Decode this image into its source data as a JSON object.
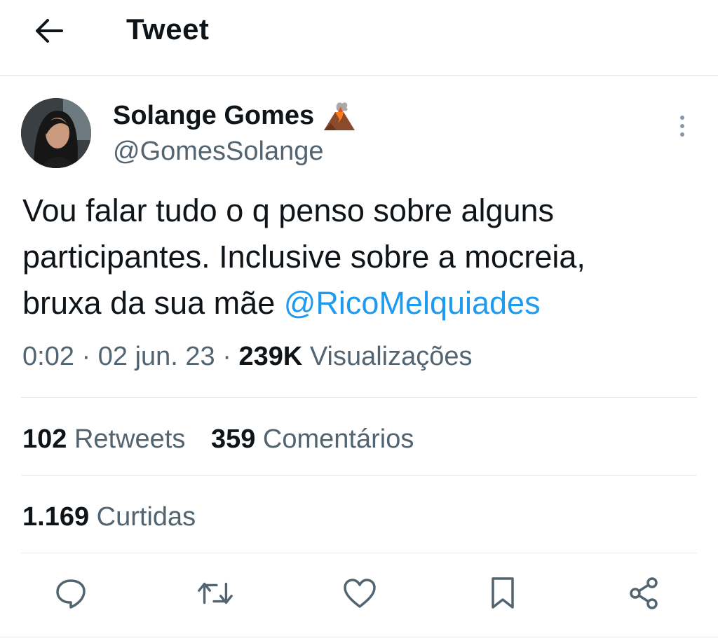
{
  "header": {
    "title": "Tweet",
    "back_icon": "arrow-left-icon"
  },
  "tweet": {
    "author_name": "Solange Gomes",
    "author_emoji": "volcano-icon",
    "author_handle": "@GomesSolange",
    "text_lines": [
      "Vou falar tudo o q penso sobre alguns",
      "participantes. Inclusive sobre a mocreia,",
      "bruxa da sua mãe "
    ],
    "mention": "@RicoMelquiades",
    "time": "0:02",
    "separator": " · ",
    "date": "02 jun. 23",
    "views_count": "239K",
    "views_label": "Visualizações"
  },
  "stats": {
    "retweets_count": "102",
    "retweets_label": "Retweets",
    "comments_count": "359",
    "comments_label": "Comentários",
    "likes_count": "1.169",
    "likes_label": "Curtidas"
  },
  "actions": [
    {
      "icon": "reply-icon"
    },
    {
      "icon": "retweet-icon"
    },
    {
      "icon": "like-icon"
    },
    {
      "icon": "bookmark-icon"
    },
    {
      "icon": "share-icon"
    }
  ],
  "colors": {
    "text": "#0f1419",
    "secondary": "#536471",
    "link": "#1d9bf0",
    "divider": "#e6ecf0"
  }
}
